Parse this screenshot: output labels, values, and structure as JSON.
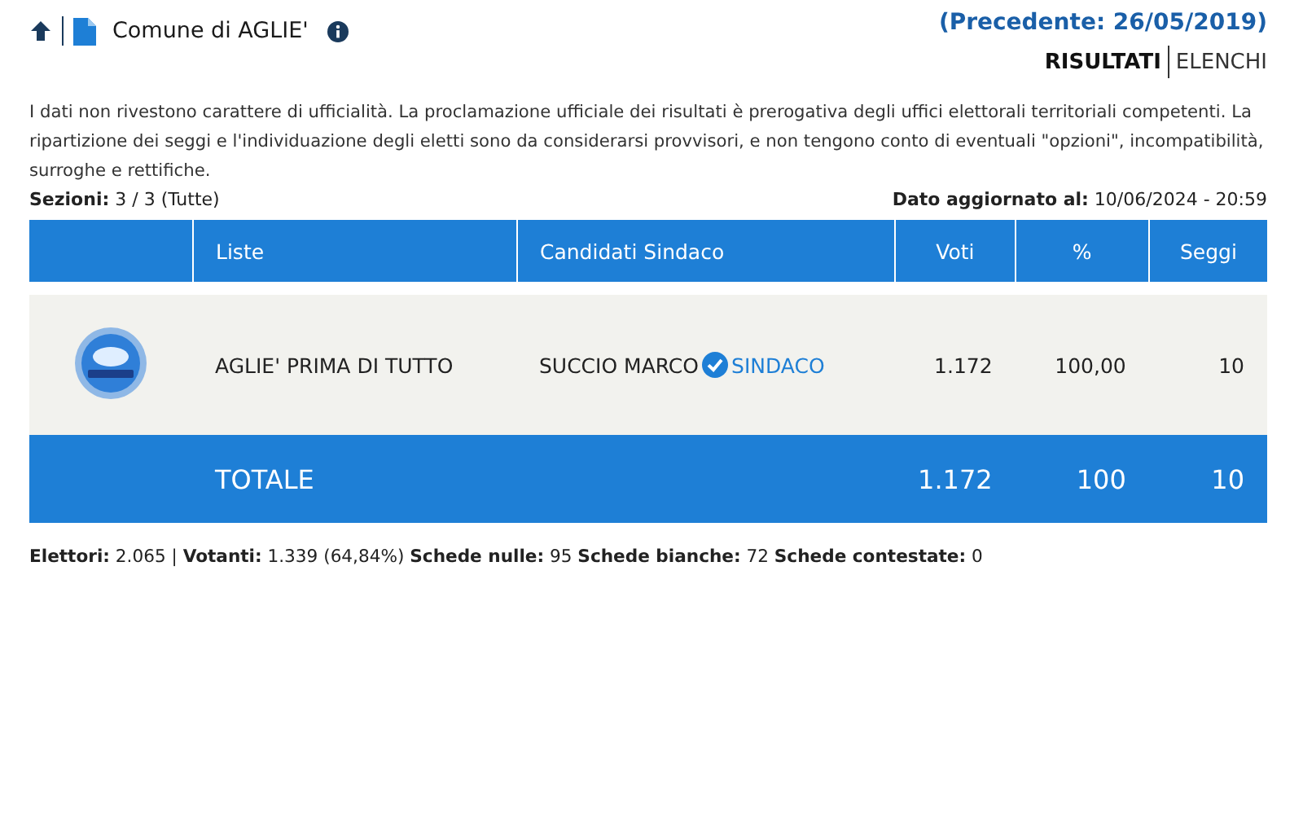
{
  "header": {
    "title": "Comune di AGLIE'",
    "previous": "(Precedente: 26/05/2019)"
  },
  "tabs": [
    {
      "label": "RISULTATI",
      "selected": true
    },
    {
      "label": "ELENCHI",
      "selected": false
    }
  ],
  "notice": "I dati non rivestono carattere di ufficialità. La proclamazione ufficiale dei risultati è prerogativa degli uffici elettorali territoriali competenti. La ripartizione dei seggi e l'individuazione degli eletti sono da considerarsi provvisori, e non tengono conto di eventuali \"opzioni\", incompatibilità, surroghe e rettifiche.",
  "sections": "**Sezioni:** 3 / 3 (Tutte)",
  "updated": "**Dato aggiornato al:** 10/06/2024 - 20:59",
  "table": {
    "columns": [
      "Liste",
      "Candidati Sindaco",
      "Voti",
      "%",
      "Seggi"
    ],
    "rows": [
      {
        "lista": "AGLIE' PRIMA DI TUTTO",
        "candidate": "SUCCIO MARCO",
        "elected": true,
        "badge": "SINDACO",
        "voti": "1.172",
        "pct": "100,00",
        "seggi": "10"
      }
    ],
    "total": {
      "label": "TOTALE",
      "voti": "1.172",
      "pct": "100",
      "seggi": "10"
    }
  },
  "stats": "**Elettori:** 2.065 | **Votanti:** 1.339 (64,84%) **Schede nulle:** 95 **Schede bianche:** 72 **Schede contestate:** 0"
}
